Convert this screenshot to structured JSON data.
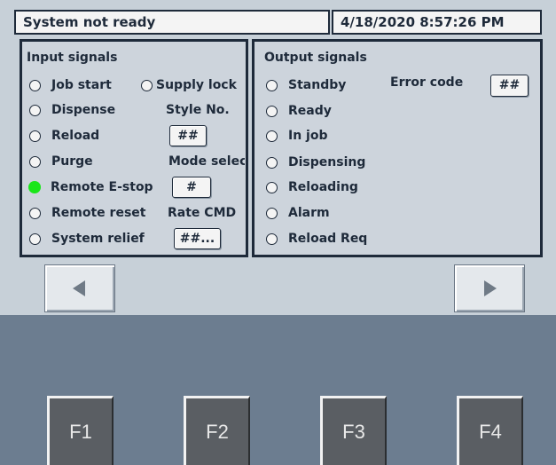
{
  "header": {
    "status": "System not ready",
    "datetime": "4/18/2020 8:57:26 PM"
  },
  "input_panel": {
    "title": "Input signals",
    "signals": [
      {
        "label": "Job start",
        "active": false
      },
      {
        "label": "Dispense",
        "active": false
      },
      {
        "label": "Reload",
        "active": false
      },
      {
        "label": "Purge",
        "active": false
      },
      {
        "label": "Remote E-stop",
        "active": true
      },
      {
        "label": "Remote reset",
        "active": false
      },
      {
        "label": "System relief",
        "active": false
      }
    ],
    "supply_lock": {
      "label": "Supply lock",
      "active": false
    },
    "style_no": {
      "label": "Style No.",
      "value": "##"
    },
    "mode_select": {
      "label": "Mode select",
      "value": "#"
    },
    "rate_cmd": {
      "label": "Rate CMD",
      "value": "##..."
    }
  },
  "output_panel": {
    "title": "Output signals",
    "signals": [
      {
        "label": "Standby",
        "active": false
      },
      {
        "label": "Ready",
        "active": false
      },
      {
        "label": "In job",
        "active": false
      },
      {
        "label": "Dispensing",
        "active": false
      },
      {
        "label": "Reloading",
        "active": false
      },
      {
        "label": "Alarm",
        "active": false
      },
      {
        "label": "Reload Req",
        "active": false
      }
    ],
    "error_code": {
      "label": "Error code",
      "value": "##"
    }
  },
  "nav": {
    "prev_icon": "triangle-left-icon",
    "next_icon": "triangle-right-icon"
  },
  "function_keys": [
    "F1",
    "F2",
    "F3",
    "F4"
  ],
  "colors": {
    "background": "#c7d0d8",
    "lower_background": "#6c7d90",
    "border": "#1e2a3a",
    "active_indicator": "#19e619",
    "function_key": "#5a5e63"
  }
}
